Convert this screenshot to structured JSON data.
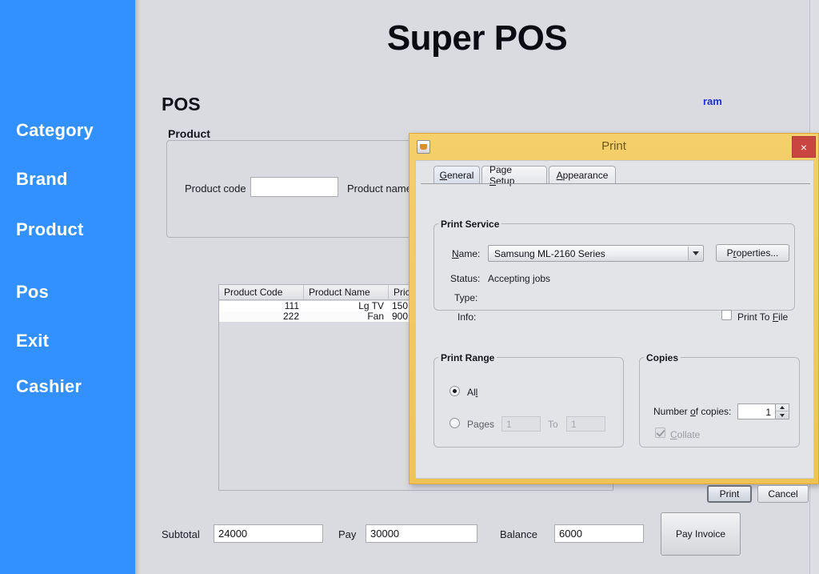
{
  "app": {
    "title": "Super POS",
    "page_title": "POS",
    "user": "ram",
    "accent_blue": "#3391ff",
    "link_blue": "#2530c8",
    "dialog_frame": "#f0c355",
    "background": "#d9dbe1"
  },
  "sidebar": {
    "items": [
      {
        "label": "Category",
        "icon": "category-icon"
      },
      {
        "label": "Brand",
        "icon": "brand-icon"
      },
      {
        "label": "Product",
        "icon": "product-icon"
      },
      {
        "label": "Pos",
        "icon": "pos-icon"
      },
      {
        "label": "Exit",
        "icon": "exit-icon"
      },
      {
        "label": "Cashier",
        "icon": "cashier-icon"
      }
    ]
  },
  "product_group": {
    "legend": "Product",
    "product_code_label": "Product code",
    "product_code_value": "",
    "product_code_placeholder": "",
    "product_name_label": "Product name"
  },
  "grid": {
    "columns": [
      "Product Code",
      "Product Name",
      "Pric"
    ],
    "rows": [
      [
        "111",
        "Lg TV",
        "150"
      ],
      [
        "222",
        "Fan",
        "900"
      ]
    ]
  },
  "totals": {
    "subtotal_label": "Subtotal",
    "subtotal_value": "24000",
    "pay_label": "Pay",
    "pay_value": "30000",
    "balance_label": "Balance",
    "balance_value": "6000",
    "pay_invoice_label": "Pay Invoice"
  },
  "print_dialog": {
    "title": "Print",
    "window_icon": "java-coffee-cup-icon",
    "close_label": "×",
    "tabs": [
      {
        "label": "General",
        "mnemonic": "G",
        "active": true
      },
      {
        "label": "Page Setup",
        "mnemonic": "S",
        "active": false
      },
      {
        "label": "Appearance",
        "mnemonic": "A",
        "active": false
      }
    ],
    "print_service": {
      "legend": "Print Service",
      "name_label": "Name:",
      "name_mnemonic": "N",
      "name_value": "Samsung ML-2160 Series",
      "properties_label": "Properties...",
      "properties_mnemonic": "r",
      "status_label": "Status:",
      "status_value": "Accepting jobs",
      "type_label": "Type:",
      "type_value": "",
      "info_label": "Info:",
      "info_value": "",
      "print_to_file_label": "Print To File",
      "print_to_file_mnemonic": "F",
      "print_to_file_checked": false
    },
    "print_range": {
      "legend": "Print Range",
      "all_label": "All",
      "all_mnemonic": "l",
      "all_selected": true,
      "pages_label": "Pages",
      "pages_mnemonic": "g",
      "pages_selected": false,
      "pages_from": "1",
      "to_label": "To",
      "pages_to": "1"
    },
    "copies": {
      "legend": "Copies",
      "number_label": "Number of copies:",
      "number_mnemonic": "o",
      "number_value": "1",
      "collate_label": "Collate",
      "collate_mnemonic": "C",
      "collate_checked": true,
      "collate_enabled": false
    },
    "buttons": {
      "print_label": "Print",
      "cancel_label": "Cancel"
    }
  }
}
